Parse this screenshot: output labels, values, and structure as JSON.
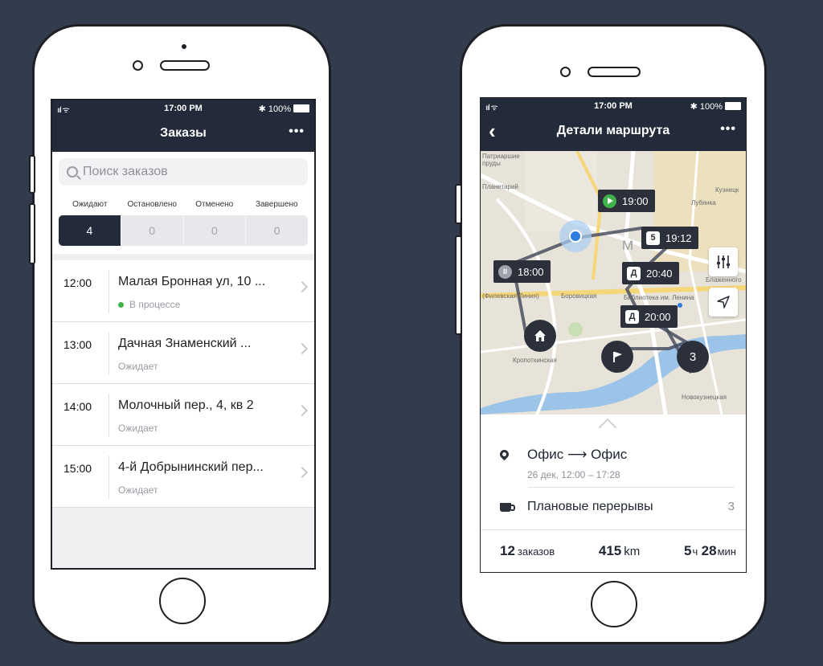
{
  "colors": {
    "background": "#323c4c",
    "navbar": "#232b3a",
    "accent_green": "#3fb34a"
  },
  "left_phone": {
    "status": {
      "signal": "ııl ᯤ",
      "time": "17:00 PM",
      "battery": "✱ 100%"
    },
    "nav": {
      "title": "Заказы",
      "more": "•••"
    },
    "search": {
      "placeholder": "Поиск заказов"
    },
    "segments": {
      "labels": [
        "Ожидают",
        "Остановлено",
        "Отменено",
        "Завершено"
      ],
      "counts": [
        "4",
        "0",
        "0",
        "0"
      ],
      "active_index": 0
    },
    "orders": [
      {
        "time": "12:00",
        "address": "Малая Бронная ул, 10 ...",
        "status": "В процессе",
        "in_progress": true
      },
      {
        "time": "13:00",
        "address": "Дачная Знаменский ...",
        "status": "Ожидает",
        "in_progress": false
      },
      {
        "time": "14:00",
        "address": "Молочный пер., 4, кв 2",
        "status": "Ожидает",
        "in_progress": false
      },
      {
        "time": "15:00",
        "address": "4-й Добрынинский пер...",
        "status": "Ожидает",
        "in_progress": false
      }
    ]
  },
  "right_phone": {
    "status": {
      "signal": "ııl ᯤ",
      "time": "17:00 PM",
      "battery": "✱ 100%"
    },
    "nav": {
      "title": "Детали маршрута",
      "more": "•••",
      "back": "‹"
    },
    "map": {
      "labels": {
        "patriarshie": "Патриаршие пруды",
        "planetarium": "Планетарий",
        "kuznetsky": "Кузнецк",
        "lubyanka": "Лубянка",
        "blazhenny": "Блаженного",
        "filevskaya": "(Филевская Линия)",
        "borovitskaya": "Боровицкая",
        "biblioteka": "Библиотека им. Ленина",
        "kropotkinskaya": "Кропоткинская",
        "novokuznetskaya": "Новокузнецкая",
        "moscow_letter": "М"
      },
      "stops": [
        {
          "time": "19:00",
          "kind": "start"
        },
        {
          "time": "19:12",
          "badge": "5"
        },
        {
          "time": "18:00",
          "kind": "pause"
        },
        {
          "time": "20:40",
          "badge": "Д"
        },
        {
          "time": "20:00",
          "badge": "Д"
        }
      ],
      "cluster_count": "3"
    },
    "route": {
      "from": "Офис",
      "arrow": "⟶",
      "to": "Офис",
      "date": "26 дек, 12:00 – 17:28"
    },
    "breaks": {
      "label": "Плановые перерывы",
      "count": "3"
    },
    "stats": {
      "orders_value": "12",
      "orders_unit": "заказов",
      "distance_value": "415",
      "distance_unit": "km",
      "hours_value": "5",
      "hours_unit": "ч",
      "minutes_value": "28",
      "minutes_unit": "мин"
    }
  }
}
